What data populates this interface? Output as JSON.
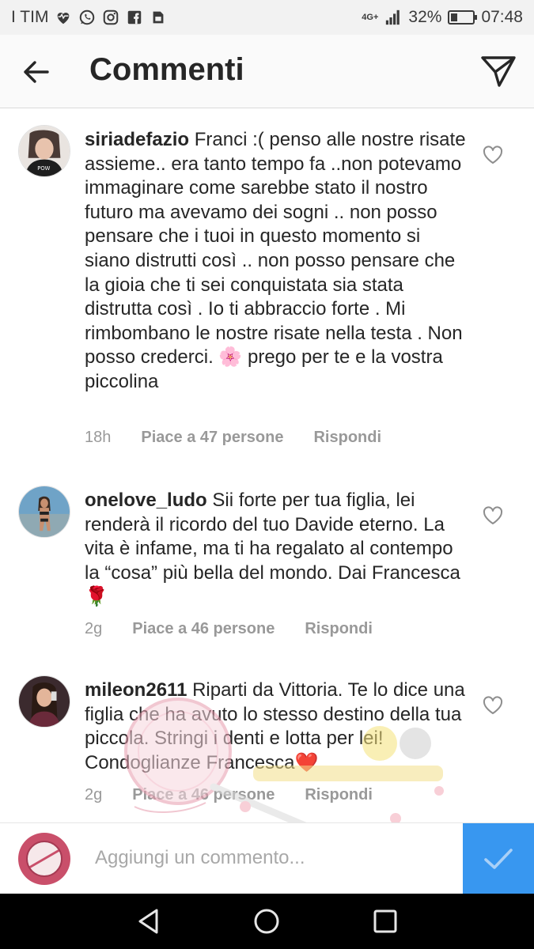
{
  "status_bar": {
    "carrier": "I TIM",
    "network": "4G+",
    "battery": "32%",
    "battery_level": 0.32,
    "time": "07:48"
  },
  "header": {
    "title": "Commenti"
  },
  "comments": [
    {
      "username": "siriadefazio",
      "text_before_emoji": "Franci :( penso alle nostre risate assieme.. era tanto tempo fa ..non potevamo immaginare come sarebbe stato il nostro futuro ma avevamo dei sogni .. non posso pensare che i tuoi in questo momento si siano distrutti così .. non posso pensare che la gioia che ti sei conquistata sia stata distrutta così . Io ti abbraccio forte . Mi rimbombano le nostre risate nella testa . Non posso crederci.",
      "emoji": "🌸",
      "text_after_emoji": "prego per te e la vostra piccolina",
      "age": "18h",
      "likes": "Piace a 47 persone",
      "reply": "Rispondi"
    },
    {
      "username": "onelove_ludo",
      "text_before_emoji": "Sii forte per tua figlia, lei renderà il ricordo del tuo Davide eterno. La vita è infame, ma ti ha regalato al contempo la “cosa” più bella del mondo. Dai Francesca",
      "emoji": "🌹",
      "text_after_emoji": "",
      "age": "2g",
      "likes": "Piace a 46 persone",
      "reply": "Rispondi"
    },
    {
      "username": "mileon2611",
      "text_before_emoji": "Riparti da Vittoria. Te lo dice una figlia che ha avuto lo stesso destino della tua piccola. Stringi i denti e lotta per lei! Condoglianze Francesca",
      "emoji": "❤️",
      "text_after_emoji": "",
      "age": "2g",
      "likes": "Piace a 46 persone",
      "reply": "Rispondi"
    }
  ],
  "composer": {
    "placeholder": "Aggiungi un commento..."
  },
  "colors": {
    "accent": "#3897f0",
    "meta_gray": "#999999",
    "text": "#262626"
  },
  "icons": {
    "back": "arrow-left-icon",
    "send": "paper-plane-icon",
    "like": "heart-outline-icon",
    "post": "checkmark-icon"
  }
}
